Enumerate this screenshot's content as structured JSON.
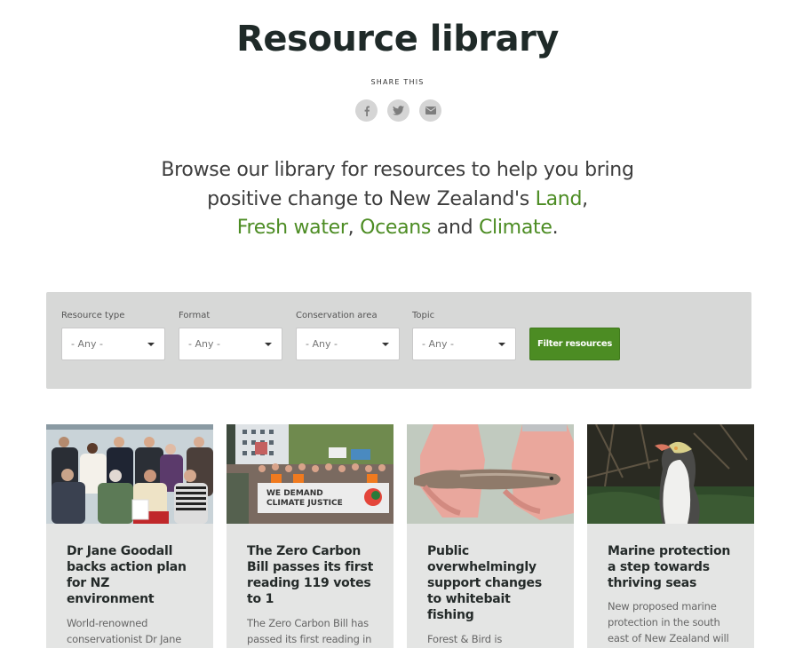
{
  "header": {
    "title": "Resource library",
    "share_label": "SHARE THIS",
    "share_icons": [
      {
        "name": "facebook-icon"
      },
      {
        "name": "twitter-icon"
      },
      {
        "name": "email-icon"
      }
    ]
  },
  "intro": {
    "text_before": "Browse our library for resources to help you bring positive change to New Zealand's ",
    "links": [
      "Land",
      "Fresh water",
      "Oceans",
      "Climate"
    ],
    "sep1": ",",
    "sep2": ", ",
    "sep3": " and ",
    "end": "."
  },
  "colors": {
    "accent": "#4c8c23",
    "title": "#1f2a28",
    "panel": "#d7d8d7",
    "card": "#e4e5e4"
  },
  "filters": {
    "groups": [
      {
        "label": "Resource type",
        "value": "- Any -"
      },
      {
        "label": "Format",
        "value": "- Any -"
      },
      {
        "label": "Conservation area",
        "value": "- Any -"
      },
      {
        "label": "Topic",
        "value": "- Any -"
      }
    ],
    "button_label": "Filter resources"
  },
  "cards": [
    {
      "image_alt": "Group photo with Dr Jane Goodall",
      "title": "Dr Jane Goodall backs action plan for NZ environment",
      "desc": "World-renowned conservationist Dr Jane"
    },
    {
      "image_alt": "Climate march with banner",
      "banner_text": "WE DEMAND CLIMATE JUSTICE",
      "title": "The Zero Carbon Bill passes its first reading 119 votes to 1",
      "desc": "The Zero Carbon Bill has passed its first reading in"
    },
    {
      "image_alt": "Whitebait fish held in hands",
      "title": "Public overwhelmingly support changes to whitebait fishing",
      "desc": "Forest & Bird is"
    },
    {
      "image_alt": "Yellow-eyed penguin",
      "title": "Marine protection a step towards thriving seas",
      "desc": "New proposed marine protection in the south east of New Zealand will"
    }
  ]
}
